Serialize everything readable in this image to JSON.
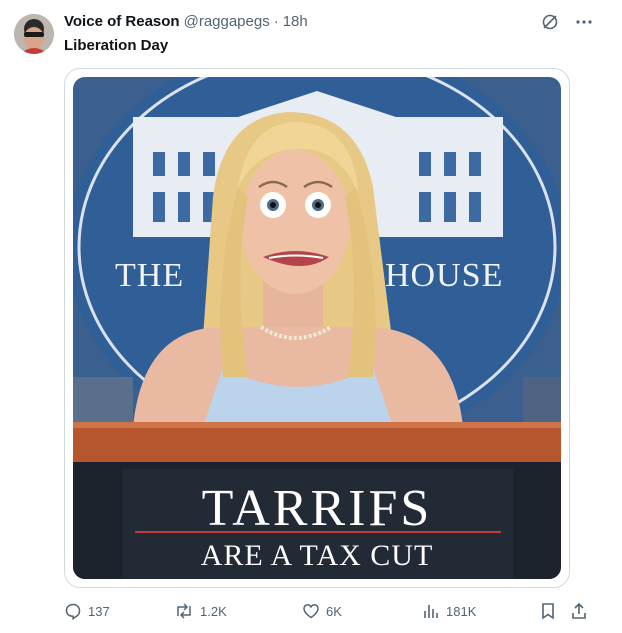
{
  "post": {
    "author_name": "Voice of Reason",
    "author_handle": "@raggapegs",
    "separator": "·",
    "time": "18h",
    "text": "Liberation Day"
  },
  "media": {
    "backdrop_left": "THE",
    "backdrop_right": "HOUSE",
    "sign_line1": "TARRIFS",
    "sign_line2": "ARE A TAX CUT"
  },
  "actions": {
    "replies": "137",
    "reposts": "1.2K",
    "likes": "6K",
    "views": "181K"
  },
  "icons": {
    "grok": "grok-icon",
    "more": "more-icon",
    "reply": "reply-icon",
    "repost": "repost-icon",
    "like": "heart-icon",
    "views": "views-chart-icon",
    "bookmark": "bookmark-icon",
    "share": "share-icon"
  },
  "colors": {
    "text_primary": "#0f1419",
    "text_secondary": "#536471",
    "border": "#cfd9de",
    "seal_blue": "#2f5f96",
    "podium_wood": "#b5562f"
  }
}
